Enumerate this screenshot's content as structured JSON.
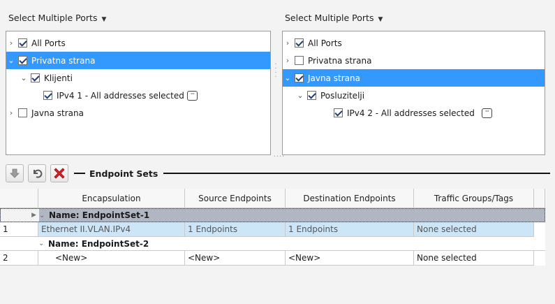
{
  "left_panel": {
    "header": "Select Multiple Ports",
    "tree": [
      {
        "label": "All Ports",
        "checked": true
      },
      {
        "label": "Privatna strana",
        "checked": true
      },
      {
        "label": "Klijenti",
        "checked": true
      },
      {
        "label": "IPv4 1 - All addresses selected",
        "checked": true
      },
      {
        "label": "Javna strana",
        "checked": false
      }
    ]
  },
  "right_panel": {
    "header": "Select Multiple Ports",
    "tree": [
      {
        "label": "All Ports",
        "checked": true
      },
      {
        "label": "Privatna strana",
        "checked": false
      },
      {
        "label": "Javna strana",
        "checked": true
      },
      {
        "label": "Posluzitelji",
        "checked": true
      },
      {
        "label": "IPv4 2 - All addresses selected",
        "checked": true
      }
    ]
  },
  "more_button_label": "···",
  "toolbar": {
    "section_title": "Endpoint Sets"
  },
  "grid": {
    "columns": [
      "Encapsulation",
      "Source Endpoints",
      "Destination Endpoints",
      "Traffic Groups/Tags"
    ],
    "groups": [
      {
        "name": "Name: EndpointSet-1",
        "rows": [
          {
            "num": "1",
            "encapsulation": "Ethernet II.VLAN.IPv4",
            "source": "1 Endpoints",
            "destination": "1 Endpoints",
            "traffic": "None selected"
          }
        ]
      },
      {
        "name": "Name: EndpointSet-2",
        "rows": [
          {
            "num": "2",
            "encapsulation": "<New>",
            "source": "<New>",
            "destination": "<New>",
            "traffic": "None selected"
          }
        ]
      }
    ]
  },
  "colors": {
    "selection": "#3399ff",
    "row_selected": "#cde6f7",
    "group_header": "#b0b7c2",
    "delete_red": "#d9232b"
  }
}
